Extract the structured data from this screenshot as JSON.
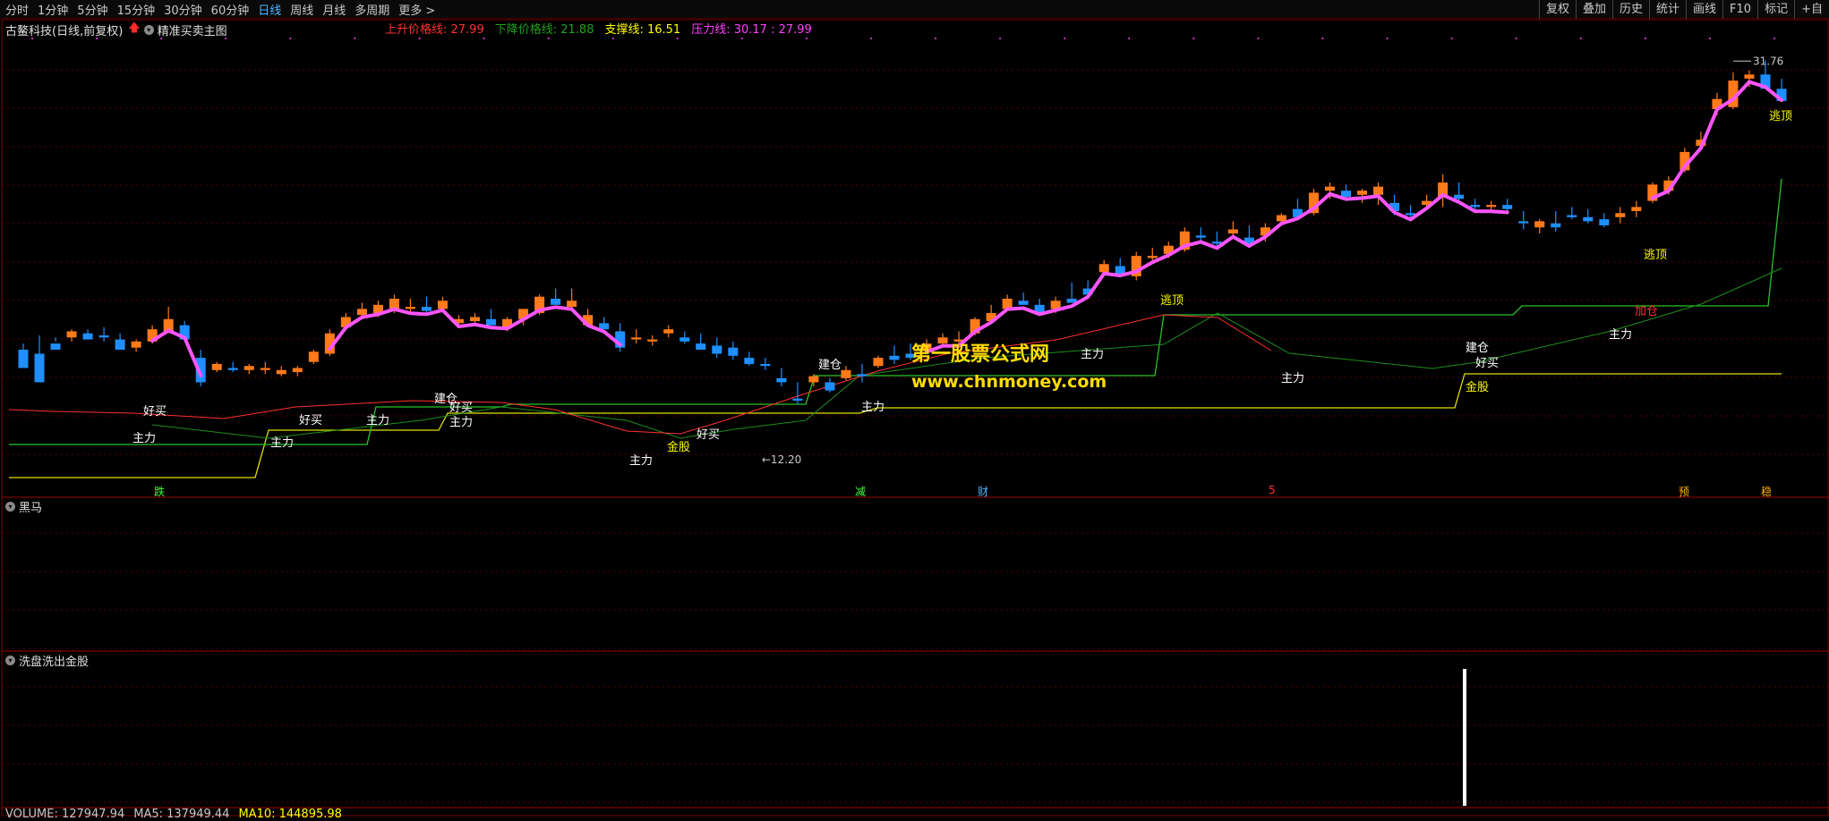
{
  "toolbar": {
    "periods": [
      {
        "label": "分时"
      },
      {
        "label": "1分钟"
      },
      {
        "label": "5分钟"
      },
      {
        "label": "15分钟"
      },
      {
        "label": "30分钟"
      },
      {
        "label": "60分钟"
      },
      {
        "label": "日线",
        "active": true
      },
      {
        "label": "周线"
      },
      {
        "label": "月线"
      },
      {
        "label": "多周期"
      },
      {
        "label": "更多 >"
      }
    ],
    "buttons": [
      "复权",
      "叠加",
      "历史",
      "统计",
      "画线",
      "F10",
      "标记",
      "+自"
    ]
  },
  "main_pane": {
    "stock": "古鳌科技(日线,前复权)",
    "indicator": "精准买卖主图",
    "legend": [
      {
        "text": "上升价格线: 27.99",
        "color": "#ff3030"
      },
      {
        "text": "下降价格线: 21.88",
        "color": "#1fa21f"
      },
      {
        "text": "支撑线: 16.51",
        "color": "#ffff00"
      },
      {
        "text": "压力线: 30.17 : 27.99",
        "color": "#ff40ff"
      }
    ],
    "high_label": "31.76",
    "low_label": "12.20",
    "watermark_title": "第一股票公式网",
    "watermark_url": "www.chnmoney.com",
    "signals": [
      {
        "t": "主力",
        "c": "#ffffff"
      },
      {
        "t": "主力",
        "c": "#ffffff"
      },
      {
        "t": "主力",
        "c": "#ffffff"
      },
      {
        "t": "主力",
        "c": "#ffffff"
      },
      {
        "t": "主力",
        "c": "#ffffff"
      },
      {
        "t": "主力",
        "c": "#ffffff"
      },
      {
        "t": "主力",
        "c": "#ffffff"
      },
      {
        "t": "主力",
        "c": "#ffffff"
      },
      {
        "t": "主力",
        "c": "#ffffff"
      },
      {
        "t": "好买",
        "c": "#ffffff"
      },
      {
        "t": "好买",
        "c": "#ffffff"
      },
      {
        "t": "好买",
        "c": "#ffffff"
      },
      {
        "t": "好买",
        "c": "#ffffff"
      },
      {
        "t": "好买",
        "c": "#ffffff"
      },
      {
        "t": "建仓",
        "c": "#ffffff"
      },
      {
        "t": "建仓",
        "c": "#ffffff"
      },
      {
        "t": "建仓",
        "c": "#ffffff"
      },
      {
        "t": "金股",
        "c": "#ffff00"
      },
      {
        "t": "金股",
        "c": "#ffff00"
      },
      {
        "t": "逃顶",
        "c": "#ffff00"
      },
      {
        "t": "逃顶",
        "c": "#ffff00"
      },
      {
        "t": "逃顶",
        "c": "#ffff00"
      },
      {
        "t": "加仓",
        "c": "#ff3030"
      }
    ],
    "bottom_marks": [
      {
        "t": "跌",
        "c": "#3cff3c"
      },
      {
        "t": "减",
        "c": "#3cff3c"
      },
      {
        "t": "财",
        "c": "#4fb3ff"
      },
      {
        "t": "5",
        "c": "#ff3030"
      },
      {
        "t": "预",
        "c": "#ffb000"
      },
      {
        "t": "稳",
        "c": "#ffb000"
      }
    ]
  },
  "pane2": {
    "title": "黑马"
  },
  "pane3": {
    "title": "洗盘洗出金股"
  },
  "volume_bar": {
    "parts": [
      {
        "text": "VOLUME: 127947.94",
        "color": "#c8c8c8"
      },
      {
        "text": "MA5: 137949.44",
        "color": "#c8c8c8"
      },
      {
        "text": "MA10: 144895.98",
        "color": "#ffff00"
      }
    ]
  },
  "chart_data": {
    "type": "candlestick",
    "price_range": [
      11.5,
      33.0
    ],
    "high_label_value": 31.76,
    "low_label_value": 12.2,
    "candles": [
      [
        17.6,
        17.9,
        17.3,
        16.7
      ],
      [
        17.4,
        18.3,
        17.0,
        16.0
      ],
      [
        17.9,
        18.2,
        18.0,
        17.6
      ],
      [
        18.2,
        18.6,
        18.0,
        18.5
      ],
      [
        18.4,
        18.6,
        18.3,
        18.1
      ],
      [
        18.3,
        18.7,
        18.0,
        18.2
      ],
      [
        18.1,
        18.4,
        17.8,
        17.6
      ],
      [
        17.7,
        18.1,
        17.5,
        18.0
      ],
      [
        18.0,
        18.8,
        17.9,
        18.6
      ],
      [
        18.5,
        19.7,
        18.4,
        19.1
      ],
      [
        18.8,
        19.0,
        18.3,
        18.1
      ],
      [
        17.2,
        17.6,
        15.8,
        16.0
      ],
      [
        16.6,
        17.0,
        16.5,
        16.9
      ],
      [
        16.7,
        17.0,
        16.5,
        16.6
      ],
      [
        16.6,
        16.9,
        16.4,
        16.8
      ],
      [
        16.6,
        17.0,
        16.4,
        16.7
      ],
      [
        16.4,
        16.8,
        16.3,
        16.6
      ],
      [
        16.5,
        16.8,
        16.3,
        16.7
      ],
      [
        17.0,
        17.6,
        16.9,
        17.5
      ],
      [
        17.4,
        18.6,
        17.3,
        18.4
      ],
      [
        18.7,
        19.4,
        18.6,
        19.2
      ],
      [
        19.3,
        19.9,
        19.1,
        19.6
      ],
      [
        19.4,
        20.0,
        19.2,
        19.8
      ],
      [
        19.6,
        20.3,
        19.4,
        20.1
      ],
      [
        19.6,
        20.1,
        19.4,
        19.7
      ],
      [
        19.7,
        20.2,
        19.4,
        19.5
      ],
      [
        19.6,
        20.2,
        19.5,
        20.0
      ],
      [
        18.9,
        19.3,
        18.7,
        19.1
      ],
      [
        19.0,
        19.4,
        18.8,
        19.2
      ],
      [
        19.1,
        19.6,
        18.9,
        18.8
      ],
      [
        18.7,
        19.2,
        18.5,
        19.1
      ],
      [
        19.1,
        19.4,
        18.8,
        19.6
      ],
      [
        19.4,
        20.3,
        19.3,
        20.2
      ],
      [
        20.1,
        20.6,
        19.9,
        19.8
      ],
      [
        19.7,
        20.6,
        19.5,
        20.0
      ],
      [
        18.8,
        19.6,
        18.7,
        19.3
      ],
      [
        18.9,
        19.2,
        18.7,
        18.6
      ],
      [
        18.5,
        18.9,
        17.5,
        17.7
      ],
      [
        18.1,
        18.6,
        17.9,
        18.2
      ],
      [
        18.0,
        18.3,
        17.8,
        18.1
      ],
      [
        18.4,
        18.8,
        18.2,
        18.6
      ],
      [
        18.2,
        18.5,
        17.9,
        18.0
      ],
      [
        17.9,
        18.4,
        17.8,
        17.6
      ],
      [
        17.8,
        18.2,
        17.2,
        17.4
      ],
      [
        17.7,
        18.0,
        17.1,
        17.3
      ],
      [
        17.2,
        17.5,
        16.8,
        16.9
      ],
      [
        16.9,
        17.2,
        16.6,
        16.8
      ],
      [
        16.2,
        16.7,
        15.8,
        16.0
      ],
      [
        15.2,
        16.0,
        14.9,
        15.1
      ],
      [
        16.0,
        16.4,
        15.8,
        16.3
      ],
      [
        16.0,
        16.2,
        15.5,
        15.6
      ],
      [
        16.2,
        16.8,
        16.1,
        16.6
      ],
      [
        16.4,
        16.9,
        16.0,
        16.3
      ],
      [
        16.8,
        17.3,
        16.7,
        17.2
      ],
      [
        17.3,
        17.8,
        16.9,
        17.1
      ],
      [
        17.4,
        17.9,
        17.1,
        17.2
      ],
      [
        17.6,
        18.1,
        17.4,
        17.9
      ],
      [
        17.9,
        18.4,
        17.7,
        18.2
      ],
      [
        18.0,
        18.5,
        17.8,
        18.1
      ],
      [
        18.4,
        19.2,
        18.3,
        19.1
      ],
      [
        19.0,
        19.8,
        18.9,
        19.4
      ],
      [
        19.6,
        20.3,
        19.5,
        20.1
      ],
      [
        20.0,
        20.4,
        19.8,
        19.8
      ],
      [
        19.8,
        20.1,
        19.5,
        19.4
      ],
      [
        19.6,
        20.2,
        19.4,
        20.0
      ],
      [
        20.1,
        20.9,
        20.0,
        19.9
      ],
      [
        20.6,
        21.0,
        20.2,
        20.3
      ],
      [
        21.4,
        22.0,
        21.2,
        21.8
      ],
      [
        21.7,
        22.1,
        21.5,
        21.3
      ],
      [
        21.2,
        22.4,
        21.0,
        22.2
      ],
      [
        22.1,
        22.6,
        21.9,
        22.2
      ],
      [
        22.3,
        22.9,
        22.1,
        22.7
      ],
      [
        22.5,
        23.6,
        22.4,
        23.4
      ],
      [
        23.2,
        23.6,
        22.9,
        23.1
      ],
      [
        22.9,
        23.4,
        22.6,
        22.8
      ],
      [
        23.3,
        23.9,
        23.1,
        23.5
      ],
      [
        23.1,
        23.7,
        22.7,
        22.8
      ],
      [
        23.2,
        23.8,
        22.9,
        23.6
      ],
      [
        23.9,
        24.3,
        23.7,
        24.2
      ],
      [
        24.5,
        25.0,
        24.2,
        24.1
      ],
      [
        24.3,
        25.5,
        24.2,
        25.3
      ],
      [
        25.4,
        25.8,
        25.0,
        25.6
      ],
      [
        25.4,
        25.7,
        24.9,
        25.1
      ],
      [
        25.2,
        25.5,
        24.8,
        25.4
      ],
      [
        25.2,
        25.8,
        24.7,
        25.6
      ],
      [
        24.8,
        25.2,
        24.2,
        24.4
      ],
      [
        24.3,
        24.7,
        24.0,
        24.2
      ],
      [
        24.7,
        25.2,
        24.5,
        24.9
      ],
      [
        25.1,
        26.2,
        24.6,
        25.8
      ],
      [
        25.2,
        25.8,
        24.9,
        25.0
      ],
      [
        24.7,
        25.0,
        24.4,
        24.6
      ],
      [
        24.6,
        24.9,
        24.4,
        24.7
      ],
      [
        24.7,
        25.0,
        24.3,
        24.5
      ],
      [
        23.9,
        24.4,
        23.5,
        23.8
      ],
      [
        23.6,
        24.0,
        23.3,
        23.9
      ],
      [
        23.8,
        24.4,
        23.4,
        23.6
      ],
      [
        24.2,
        24.6,
        24.0,
        24.1
      ],
      [
        24.1,
        24.5,
        23.8,
        23.9
      ],
      [
        24.0,
        24.3,
        23.6,
        23.7
      ],
      [
        24.1,
        24.6,
        23.8,
        24.3
      ],
      [
        24.4,
        24.9,
        24.1,
        24.6
      ],
      [
        24.9,
        25.8,
        24.8,
        25.7
      ],
      [
        25.4,
        26.1,
        25.2,
        25.9
      ],
      [
        26.4,
        27.5,
        26.3,
        27.3
      ],
      [
        27.6,
        28.3,
        27.4,
        27.9
      ],
      [
        29.4,
        30.2,
        29.1,
        29.9
      ],
      [
        29.5,
        31.2,
        29.4,
        30.8
      ],
      [
        30.9,
        31.3,
        30.5,
        31.1
      ],
      [
        31.1,
        31.8,
        30.8,
        30.4
      ],
      [
        30.4,
        30.9,
        29.8,
        29.8
      ]
    ],
    "series": [
      {
        "name": "VOLUME",
        "last": 127947.94
      },
      {
        "name": "MA5",
        "last": 137949.44
      },
      {
        "name": "MA10",
        "last": 144895.98
      }
    ]
  }
}
